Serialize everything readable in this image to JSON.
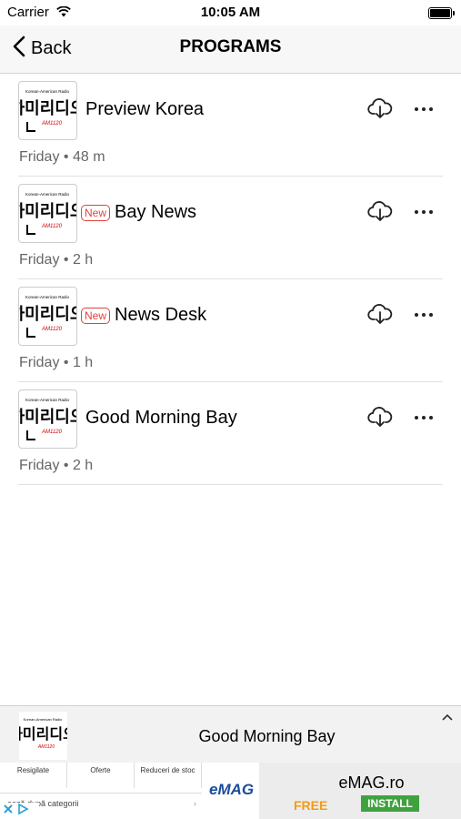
{
  "status_bar": {
    "carrier": "Carrier",
    "time": "10:05 AM"
  },
  "nav": {
    "back_label": "Back",
    "title": "PROGRAMS"
  },
  "programs": [
    {
      "title": "Preview Korea",
      "meta": "Friday • 48 m",
      "badge": ""
    },
    {
      "title": "Bay News",
      "meta": "Friday • 2 h",
      "badge": "New"
    },
    {
      "title": "News Desk",
      "meta": "Friday • 1 h",
      "badge": "New"
    },
    {
      "title": "Good Morning Bay",
      "meta": "Friday • 2 h",
      "badge": ""
    }
  ],
  "thumbnail": {
    "top_text": "Korean-American Radio",
    "hangul": "하미리디오",
    "am": "AM1120"
  },
  "mini_player": {
    "title": "Good Morning Bay"
  },
  "ad": {
    "categories": [
      "Resigilate",
      "Oferte",
      "Reduceri de stoc"
    ],
    "search_text": "ează după categorii",
    "logo": "eMAG",
    "name": "eMAG.ro",
    "free": "FREE",
    "install": "INSTALL"
  },
  "colors": {
    "badge": "#e0433b",
    "install": "#3fa23f",
    "free": "#f39c12"
  }
}
